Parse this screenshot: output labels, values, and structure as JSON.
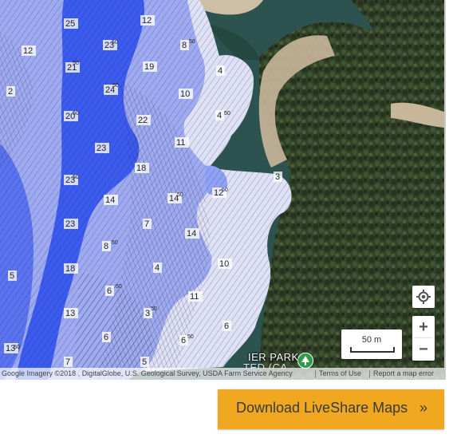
{
  "map": {
    "attribution": "Google Imagery ©2018 , DigitalGlobe, U.S. Geological Survey, USDA Farm Service Agency",
    "terms_link": "Terms of Use",
    "report_link": "Report a map error",
    "scale_label": "50 m",
    "park_label": "IER PARK",
    "park_sublabel": "TED (CA",
    "controls": {
      "locate_icon": "crosshair-locate-icon",
      "zoom_in": "+",
      "zoom_out": "−"
    },
    "depth_labels": [
      {
        "value": "25"
      },
      {
        "value": "12"
      },
      {
        "value": "23"
      },
      {
        "value": "8"
      },
      {
        "value": "12"
      },
      {
        "value": "21"
      },
      {
        "value": "19"
      },
      {
        "value": "4"
      },
      {
        "value": "2"
      },
      {
        "value": "24"
      },
      {
        "value": "10"
      },
      {
        "value": "20"
      },
      {
        "value": "22"
      },
      {
        "value": "4"
      },
      {
        "value": "11"
      },
      {
        "value": "23"
      },
      {
        "value": "18"
      },
      {
        "value": "3"
      },
      {
        "value": "23"
      },
      {
        "value": "12"
      },
      {
        "value": "14"
      },
      {
        "value": "14"
      },
      {
        "value": "23"
      },
      {
        "value": "7"
      },
      {
        "value": "14"
      },
      {
        "value": "8"
      },
      {
        "value": "10"
      },
      {
        "value": "18"
      },
      {
        "value": "4"
      },
      {
        "value": "5"
      },
      {
        "value": "6"
      },
      {
        "value": "11"
      },
      {
        "value": "13"
      },
      {
        "value": "3"
      },
      {
        "value": "6"
      },
      {
        "value": "6"
      },
      {
        "value": "6"
      },
      {
        "value": "13"
      },
      {
        "value": "5"
      },
      {
        "value": "7"
      }
    ],
    "contour_interval_label": "50",
    "colors": {
      "deep": "#3b5bf0",
      "mid": "#8f9ff5",
      "shallow": "#dcdff7",
      "land": "#3b4a33",
      "water": "#2e5a55",
      "sand": "#c9b79b"
    }
  },
  "download_button": {
    "label": "Download LiveShare Maps",
    "chevron": "»"
  }
}
